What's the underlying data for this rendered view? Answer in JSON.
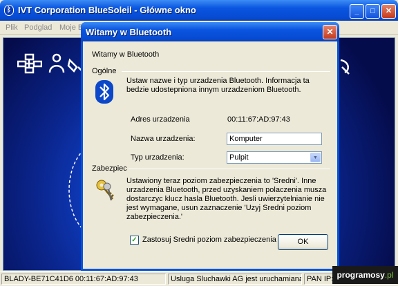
{
  "main_window": {
    "title": "IVT Corporation BlueSoleil - Główne okno",
    "minimize_label": "_",
    "maximize_label": "□",
    "close_label": "✕",
    "menu": [
      "Plik",
      "Podglad",
      "Moje B"
    ]
  },
  "dialog": {
    "title": "Witamy w Bluetooth",
    "close_label": "✕",
    "welcome_text": "Witamy w Bluetooth",
    "general": {
      "heading": "Ogólne",
      "description": "Ustaw nazwe i typ urzadzenia Bluetooth. Informacja ta bedzie udostepniona innym urzadzeniom Bluetooth.",
      "address_label": "Adres urzadzenia",
      "address_value": "00:11:67:AD:97:43",
      "name_label": "Nazwa urzadzenia:",
      "name_value": "Komputer",
      "type_label": "Typ urzadzenia:",
      "type_value": "Pulpit"
    },
    "security": {
      "heading": "Zabezpiec",
      "description": "Ustawiony teraz poziom zabezpieczenia to 'Sredni'. Inne urzadzenia Bluetooth, przed uzyskaniem polaczenia musza dostarczyc klucz hasla Bluetooth. Jesli uwierzytelnianie nie jest wymagane, usun zaznaczenie 'Uzyj Sredni poziom zabezpieczenia.'",
      "checkbox_label": "Zastosuj Sredni poziom zabezpieczenia",
      "checkbox_checked": true,
      "checkbox_mark": "✓"
    },
    "ok_label": "OK"
  },
  "statusbar": {
    "device": "BLADY-BE71C41D6 00:11:67:AD:97:43",
    "service": "Usluga Sluchawki AG jest uruchamiana.",
    "pan": "PAN IP:"
  },
  "watermark": {
    "prefix": "programosy",
    "suffix": ".pl"
  },
  "icons": {
    "app": "bluetooth-icon",
    "general": "bluetooth-logo-icon",
    "security": "keys-icon"
  },
  "colors": {
    "titlebar": "#0a55e0",
    "canvas": "#0a248a",
    "bluetooth_blue": "#0b47c8"
  }
}
